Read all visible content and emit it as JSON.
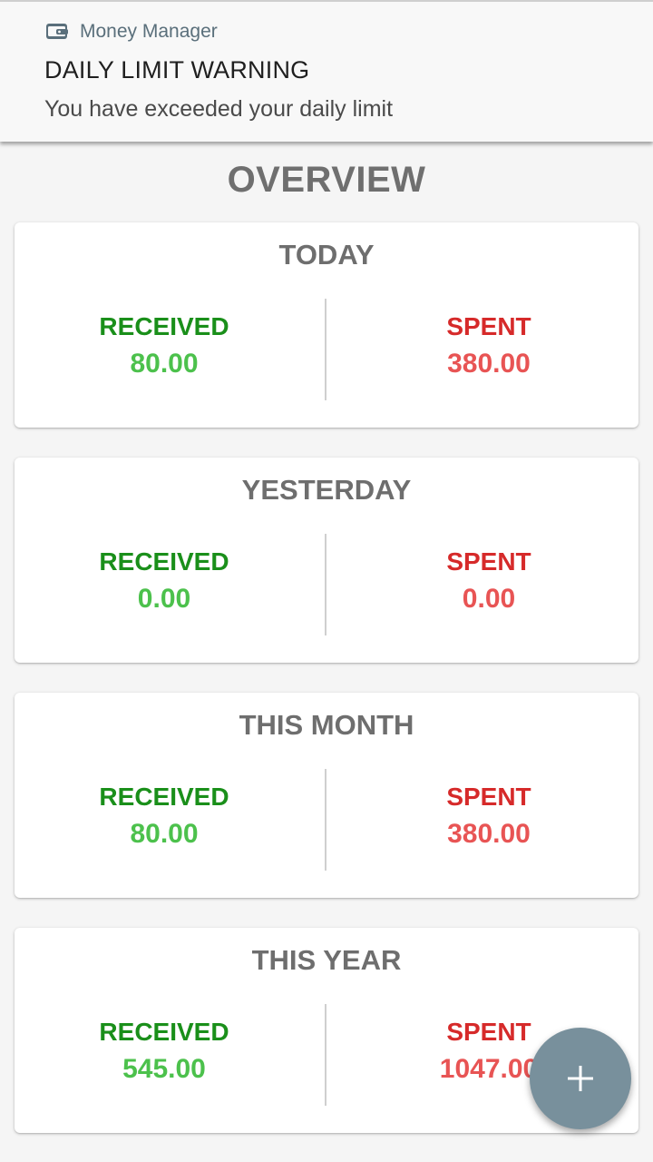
{
  "notification": {
    "app_name": "Money Manager",
    "title": "DAILY LIMIT WARNING",
    "text": "You have exceeded your daily limit",
    "icon": "wallet-icon"
  },
  "page_title": "OVERVIEW",
  "cards": [
    {
      "title": "TODAY",
      "received_label": "RECEIVED",
      "received_value": "80.00",
      "spent_label": "SPENT",
      "spent_value": "380.00"
    },
    {
      "title": "YESTERDAY",
      "received_label": "RECEIVED",
      "received_value": "0.00",
      "spent_label": "SPENT",
      "spent_value": "0.00"
    },
    {
      "title": "THIS MONTH",
      "received_label": "RECEIVED",
      "received_value": "80.00",
      "spent_label": "SPENT",
      "spent_value": "380.00"
    },
    {
      "title": "THIS YEAR",
      "received_label": "RECEIVED",
      "received_value": "545.00",
      "spent_label": "SPENT",
      "spent_value": "1047.00"
    }
  ],
  "fab": {
    "icon": "plus-icon"
  },
  "colors": {
    "received_label": "#1a8f1a",
    "received_value": "#4cc14c",
    "spent_label": "#d62a2a",
    "spent_value": "#e85454",
    "fab": "#78909c"
  }
}
